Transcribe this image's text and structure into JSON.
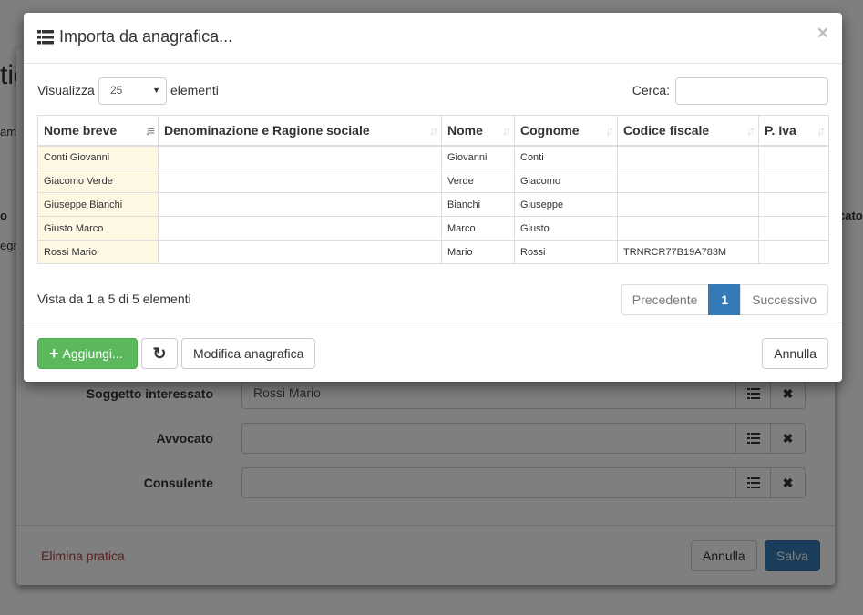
{
  "background": {
    "title_fragment": "tic",
    "left_fragment_1": "ame",
    "left_fragment_2": "o",
    "left_fragment_3": "egr",
    "right_fragment": "cato",
    "fields": [
      {
        "label": "Soggetto interessato",
        "value": "Rossi Mario"
      },
      {
        "label": "Avvocato",
        "value": ""
      },
      {
        "label": "Consulente",
        "value": ""
      }
    ],
    "delete_label": "Elimina pratica",
    "cancel_label": "Annulla",
    "save_label": "Salva",
    "colors": {
      "danger": "#a94442",
      "primary": "#337ab7"
    }
  },
  "modal": {
    "title": "Importa da anagrafica...",
    "close_symbol": "×",
    "length": {
      "prefix": "Visualizza",
      "value": "25",
      "suffix": "elementi"
    },
    "search": {
      "label": "Cerca:",
      "value": ""
    },
    "table": {
      "columns": [
        "Nome breve",
        "Denominazione e Ragione sociale",
        "Nome",
        "Cognome",
        "Codice fiscale",
        "P. Iva"
      ],
      "rows": [
        [
          "Conti Giovanni",
          "",
          "Giovanni",
          "Conti",
          "",
          ""
        ],
        [
          "Giacomo Verde",
          "",
          "Verde",
          "Giacomo",
          "",
          ""
        ],
        [
          "Giuseppe Bianchi",
          "",
          "Bianchi",
          "Giuseppe",
          "",
          ""
        ],
        [
          "Giusto Marco",
          "",
          "Marco",
          "Giusto",
          "",
          ""
        ],
        [
          "Rossi Mario",
          "",
          "Mario",
          "Rossi",
          "TRNRCR77B19A783M",
          ""
        ]
      ]
    },
    "info": "Vista da 1 a 5 di 5 elementi",
    "pagination": {
      "prev": "Precedente",
      "current": "1",
      "next": "Successivo"
    },
    "footer": {
      "add_label": "Aggiungi...",
      "add_symbol": "+",
      "refresh_symbol": "↻",
      "edit_label": "Modifica anagrafica",
      "cancel_label": "Annulla"
    },
    "colors": {
      "success": "#5cb85c",
      "active_page": "#337ab7",
      "sorted_col": "#fdf7e4"
    }
  }
}
